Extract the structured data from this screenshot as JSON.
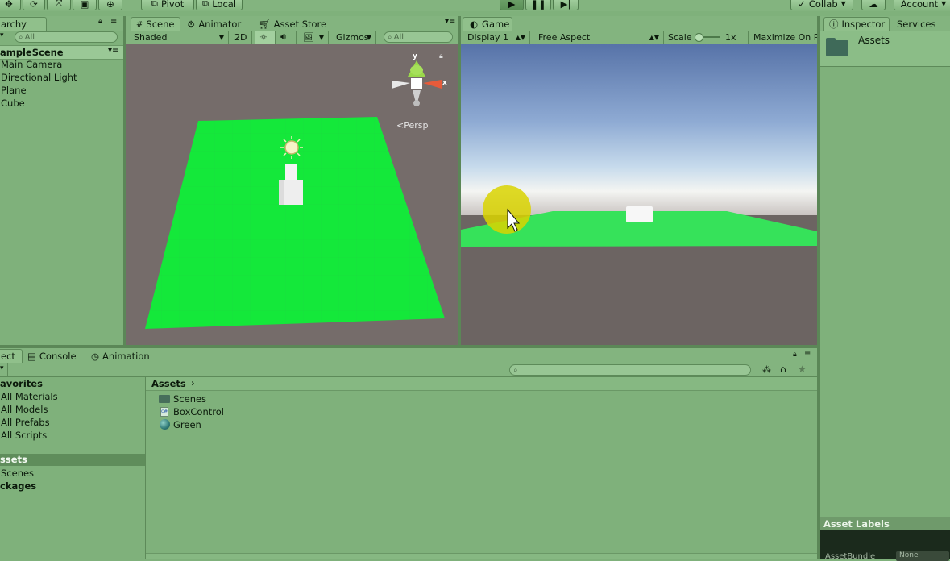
{
  "toolbar": {
    "pivot_label": "Pivot",
    "local_label": "Local",
    "collab_label": "Collab",
    "account_label": "Account"
  },
  "hierarchy": {
    "tab_label": "archy",
    "search_placeholder": "All",
    "scene_name": "ampleScene",
    "items": [
      "Main Camera",
      "Directional Light",
      "Plane",
      "Cube"
    ]
  },
  "scene_view": {
    "tabs": [
      "Scene",
      "Animator",
      "Asset Store"
    ],
    "shading_mode": "Shaded",
    "mode_2d_label": "2D",
    "gizmos_label": "Gizmos",
    "search_placeholder": "All",
    "persp_label": "Persp",
    "axis_y": "y",
    "axis_x": "x"
  },
  "game_view": {
    "tab_label": "Game",
    "display": "Display 1",
    "aspect": "Free Aspect",
    "scale_label": "Scale",
    "scale_value": "1x",
    "maximize_label": "Maximize On Pl"
  },
  "inspector": {
    "tabs": [
      "Inspector",
      "Services"
    ],
    "asset_title": "Assets",
    "asset_labels_title": "Asset Labels",
    "assetbundle_label": "AssetBundle",
    "assetbundle_value": "None"
  },
  "bottom_tabs": {
    "project_label": "ect",
    "console_label": "Console",
    "animation_label": "Animation"
  },
  "project": {
    "favorites_header": "avorites",
    "favorites": [
      "All Materials",
      "All Models",
      "All Prefabs",
      "All Scripts"
    ],
    "assets_root": "ssets",
    "assets_children": [
      "Scenes"
    ],
    "packages_label": "ckages",
    "breadcrumb_root": "Assets",
    "files": [
      {
        "name": "Scenes",
        "icon": "folder-icon"
      },
      {
        "name": "BoxControl",
        "icon": "script-icon"
      },
      {
        "name": "Green",
        "icon": "material-sphere-icon"
      }
    ]
  },
  "colors": {
    "editor_tint": "#7fb17b",
    "plane_green": "#14e83a",
    "scene_bg": "#756c6a",
    "game_ground": "#6c6462",
    "yellow_highlight": "#d9d400"
  }
}
